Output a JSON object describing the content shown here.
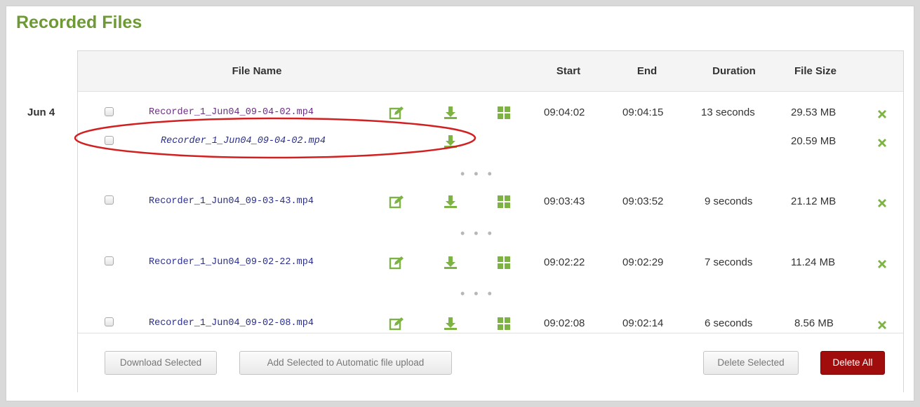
{
  "section_title": "Recorded Files",
  "columns": {
    "file_name": "File Name",
    "start": "Start",
    "end": "End",
    "duration": "Duration",
    "file_size": "File Size"
  },
  "date_group": "Jun 4",
  "rows": [
    {
      "file": "Recorder_1_Jun04_09-04-02.mp4",
      "start": "09:04:02",
      "end": "09:04:15",
      "duration": "13 seconds",
      "size": "29.53 MB"
    },
    {
      "file": "Recorder_1_Jun04_09-04-02.mp4",
      "size": "20.59 MB"
    },
    {
      "file": "Recorder_1_Jun04_09-03-43.mp4",
      "start": "09:03:43",
      "end": "09:03:52",
      "duration": "9 seconds",
      "size": "21.12 MB"
    },
    {
      "file": "Recorder_1_Jun04_09-02-22.mp4",
      "start": "09:02:22",
      "end": "09:02:29",
      "duration": "7 seconds",
      "size": "11.24 MB"
    },
    {
      "file": "Recorder_1_Jun04_09-02-08.mp4",
      "start": "09:02:08",
      "end": "09:02:14",
      "duration": "6 seconds",
      "size": "8.56 MB"
    }
  ],
  "ellipsis": "• • •",
  "buttons": {
    "download_selected": "Download Selected",
    "add_to_upload": "Add Selected to Automatic file upload",
    "delete_selected": "Delete Selected",
    "delete_all": "Delete All"
  },
  "icons": {
    "edit": "edit-icon",
    "download": "download-icon",
    "thumbnail": "thumbnail-grid-icon",
    "delete": "delete-x-icon"
  },
  "colors": {
    "accent_green": "#6e9a35",
    "icon_green": "#7cb342",
    "link": "#2a2f8f",
    "link_visited": "#6b2f82",
    "danger": "#a10d0d",
    "annotation": "#d22020"
  }
}
